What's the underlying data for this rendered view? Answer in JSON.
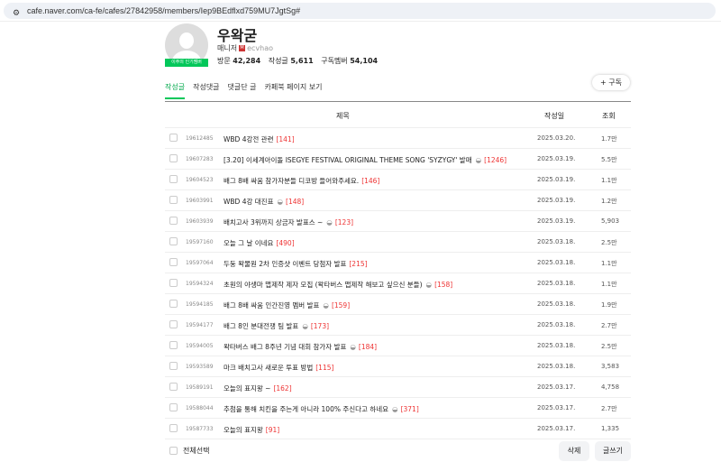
{
  "browser": {
    "url": "cafe.naver.com/ca-fe/cafes/27842958/members/Iep9BEdflxd759MU7JgtSg#"
  },
  "profile": {
    "nickname": "우왁굳",
    "badge": "이주의 인기멤버",
    "role": "매니저",
    "role_icon": "M",
    "user_id": "ecvhao",
    "stats": [
      {
        "label": "방문",
        "value": "42,284"
      },
      {
        "label": "작성글",
        "value": "5,611"
      },
      {
        "label": "구독멤버",
        "value": "54,104"
      }
    ]
  },
  "tabs": [
    "작성글",
    "작성댓글",
    "댓글단 글",
    "카페북 페이지 보기"
  ],
  "subscribe_label": "+ 구독",
  "table": {
    "headers": {
      "title": "제목",
      "date": "작성일",
      "views": "조회"
    },
    "rows": [
      {
        "num": "19612485",
        "title": "WBD 4강전 관련",
        "icon": "",
        "comments": "[141]",
        "date": "2025.03.20.",
        "views": "1.7만"
      },
      {
        "num": "19607283",
        "title": "[3.20] 이세계아이돌 ISEGYE FESTIVAL ORIGINAL THEME SONG 'SYZYGY' 발매",
        "icon": "◒",
        "comments": "[1246]",
        "date": "2025.03.19.",
        "views": "5.5만"
      },
      {
        "num": "19604523",
        "title": "배그 8배 싸움 참가자분들 디코방 들어와주세요.",
        "icon": "",
        "comments": "[146]",
        "date": "2025.03.19.",
        "views": "1.1만"
      },
      {
        "num": "19603991",
        "title": "WBD 4강 대진표",
        "icon": "◒",
        "comments": "[148]",
        "date": "2025.03.19.",
        "views": "1.2만"
      },
      {
        "num": "19603939",
        "title": "배치고사 3위까지 상금자 발표스 ~",
        "icon": "◒",
        "comments": "[123]",
        "date": "2025.03.19.",
        "views": "5,903"
      },
      {
        "num": "19597160",
        "title": "오늘 그 날 이네요",
        "icon": "",
        "comments": "[490]",
        "date": "2025.03.18.",
        "views": "2.5만"
      },
      {
        "num": "19597064",
        "title": "두둥 왁물원 2차 인증샷 이벤트 당첨자 발표",
        "icon": "",
        "comments": "[215]",
        "date": "2025.03.18.",
        "views": "1.1만"
      },
      {
        "num": "19594324",
        "title": "초원의 야생마 맵제작 제자 모집 (왁타버스 맵제작 해보고 싶으신 분들)",
        "icon": "◒",
        "comments": "[158]",
        "date": "2025.03.18.",
        "views": "1.1만"
      },
      {
        "num": "19594185",
        "title": "배그 8배 싸움 인간진영 멤버 발표",
        "icon": "◒",
        "comments": "[159]",
        "date": "2025.03.18.",
        "views": "1.9만"
      },
      {
        "num": "19594177",
        "title": "배그 8인 분대전쟁 팀 발표",
        "icon": "◒",
        "comments": "[173]",
        "date": "2025.03.18.",
        "views": "2.7만"
      },
      {
        "num": "19594005",
        "title": "왁타버스 배그 8주년 기념 대회 참가자 발표",
        "icon": "◒",
        "comments": "[184]",
        "date": "2025.03.18.",
        "views": "2.5만"
      },
      {
        "num": "19593589",
        "title": "마크 배치고사 새로운 투표 방법",
        "icon": "",
        "comments": "[115]",
        "date": "2025.03.18.",
        "views": "3,583"
      },
      {
        "num": "19589191",
        "title": "오늘의 표지왕 ~",
        "icon": "",
        "comments": "[162]",
        "date": "2025.03.17.",
        "views": "4,758"
      },
      {
        "num": "19588044",
        "title": "추첨을 통해 치킨을 주는게 아니라 100% 주신다고 하네요",
        "icon": "◒",
        "comments": "[371]",
        "date": "2025.03.17.",
        "views": "2.7만"
      },
      {
        "num": "19587733",
        "title": "오늘의 표지왕",
        "icon": "",
        "comments": "[91]",
        "date": "2025.03.17.",
        "views": "1,335"
      }
    ]
  },
  "footer": {
    "select_all": "전체선택",
    "delete": "삭제",
    "write": "글쓰기"
  }
}
